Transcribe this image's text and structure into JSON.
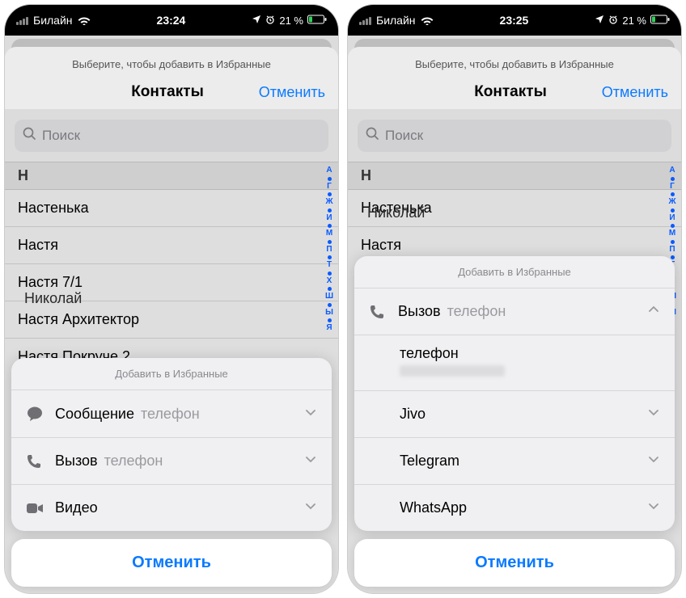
{
  "status": {
    "carrier": "Билайн",
    "battery_pct": "21 %"
  },
  "left": {
    "time": "23:24",
    "header_subtitle": "Выберите, чтобы добавить в Избранные",
    "header_title": "Контакты",
    "header_cancel": "Отменить",
    "search_placeholder": "Поиск",
    "section": "Н",
    "contacts": [
      "Настенька",
      "Настя",
      "Настя 7/1",
      "Настя Архитектор",
      "Настя Покруче 2"
    ],
    "peek_contact": "Николай",
    "sheet_title": "Добавить в Избранные",
    "rows": {
      "message": {
        "label": "Сообщение",
        "sub": "телефон"
      },
      "call": {
        "label": "Вызов",
        "sub": "телефон"
      },
      "video": {
        "label": "Видео"
      }
    },
    "cancel": "Отменить"
  },
  "right": {
    "time": "23:25",
    "header_subtitle": "Выберите, чтобы добавить в Избранные",
    "header_title": "Контакты",
    "header_cancel": "Отменить",
    "search_placeholder": "Поиск",
    "section": "Н",
    "contacts": [
      "Настенька",
      "Настя"
    ],
    "peek_contact": "Николай",
    "sheet_title": "Добавить в Избранные",
    "call": {
      "label": "Вызов",
      "sub": "телефон"
    },
    "options": {
      "phone": "телефон",
      "jivo": "Jivo",
      "telegram": "Telegram",
      "whatsapp": "WhatsApp"
    },
    "cancel": "Отменить"
  },
  "index_letters": [
    "А",
    "Г",
    "Ж",
    "И",
    "М",
    "П",
    "Т",
    "Х",
    "Ш",
    "Ы",
    "Я"
  ]
}
